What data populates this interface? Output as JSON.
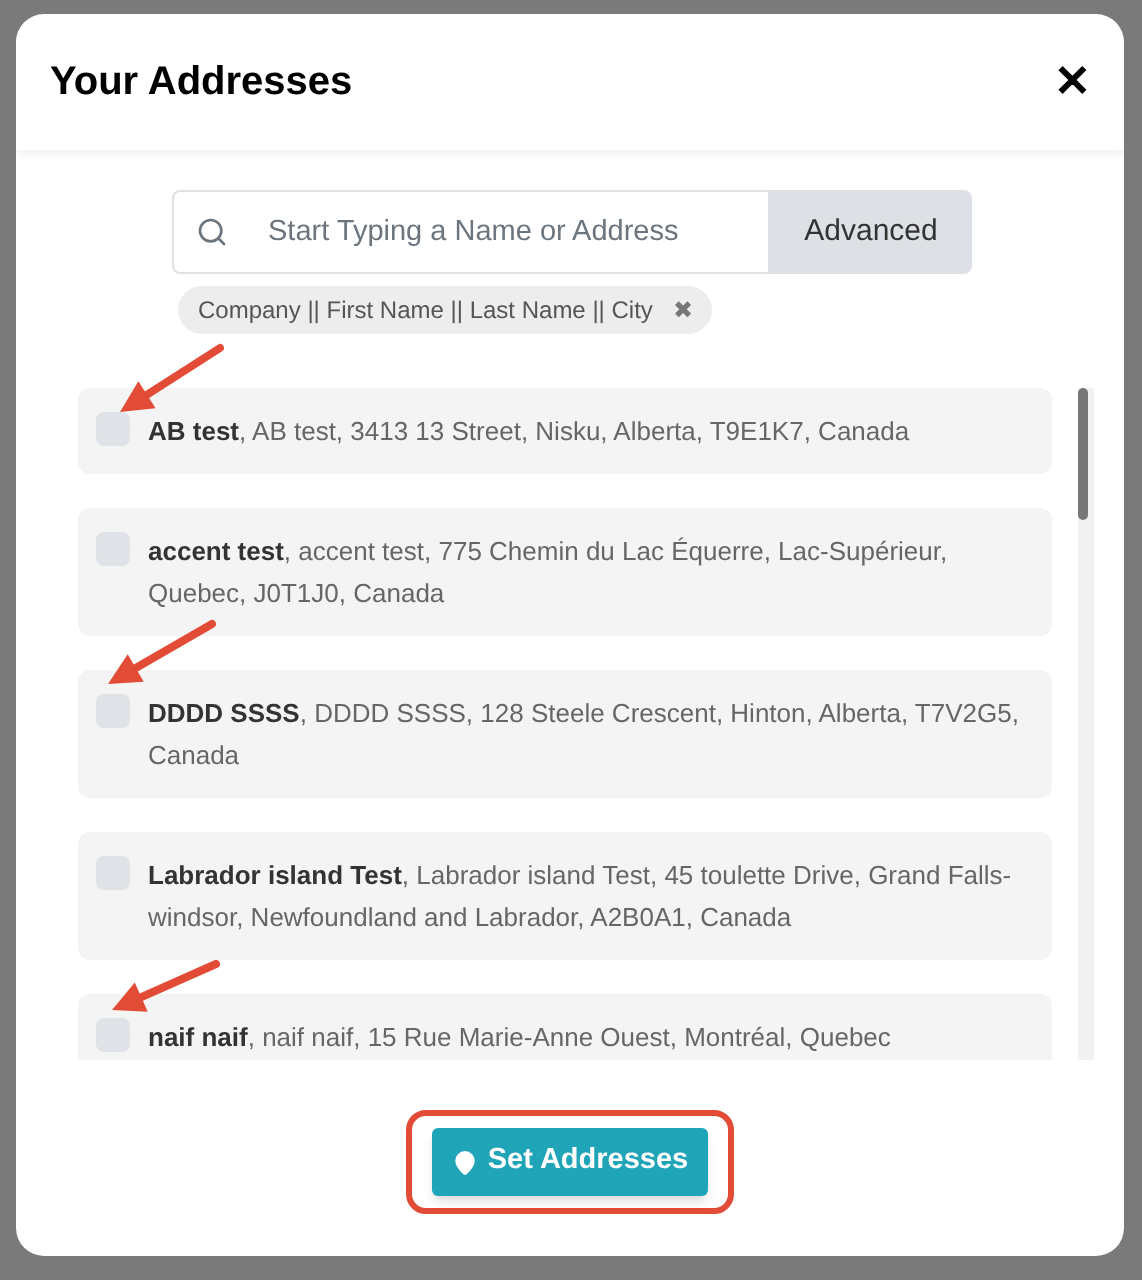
{
  "dialog": {
    "title": "Your Addresses",
    "close": "✕"
  },
  "search": {
    "placeholder": "Start Typing a Name or Address",
    "advanced_button": "Advanced"
  },
  "filter_tag": {
    "label": "Company || First Name || Last Name || City",
    "remove": "✖"
  },
  "addresses": [
    {
      "name": "AB test",
      "details": ", AB test, 3413 13 Street, Nisku, Alberta, T9E1K7, Canada",
      "checked": false
    },
    {
      "name": "accent test",
      "details": ", accent test, 775 Chemin du Lac Équerre, Lac-Supérieur, Quebec, J0T1J0, Canada",
      "checked": false
    },
    {
      "name": "DDDD SSSS",
      "details": ", DDDD SSSS, 128 Steele Crescent, Hinton, Alberta, T7V2G5, Canada",
      "checked": false
    },
    {
      "name": "Labrador island Test",
      "details": ", Labrador island Test, 45 toulette Drive, Grand Falls-windsor, Newfoundland and Labrador, A2B0A1, Canada",
      "checked": false
    },
    {
      "name": "naif naif",
      "details": ", naif naif, 15 Rue Marie-Anne Ouest, Montréal, Quebec",
      "checked": false
    }
  ],
  "set_button": "Set Addresses"
}
